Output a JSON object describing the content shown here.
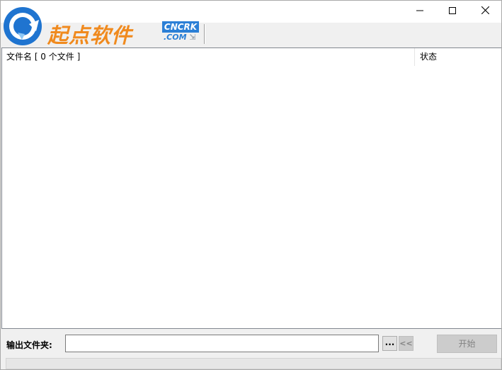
{
  "app": {
    "logo_text": "起点软件",
    "logo_badge_top": "CNCRK",
    "logo_badge_bottom": ".COM",
    "logo_badge_mark": "⇲"
  },
  "window_controls": [
    "minimize-icon",
    "maximize-icon",
    "close-icon"
  ],
  "file_list": {
    "columns": [
      "文件名 [ 0 个文件 ]",
      "状态"
    ],
    "rows": []
  },
  "output": {
    "label": "输出文件夹:",
    "value": "",
    "placeholder": "",
    "browse_label": "...",
    "back_label": "<<"
  },
  "start_button": {
    "label": "开始",
    "enabled": false
  },
  "colors": {
    "logo_orange": "#f08a1e",
    "logo_blue": "#2b7fd6",
    "disabled_button": "#cccccc"
  }
}
